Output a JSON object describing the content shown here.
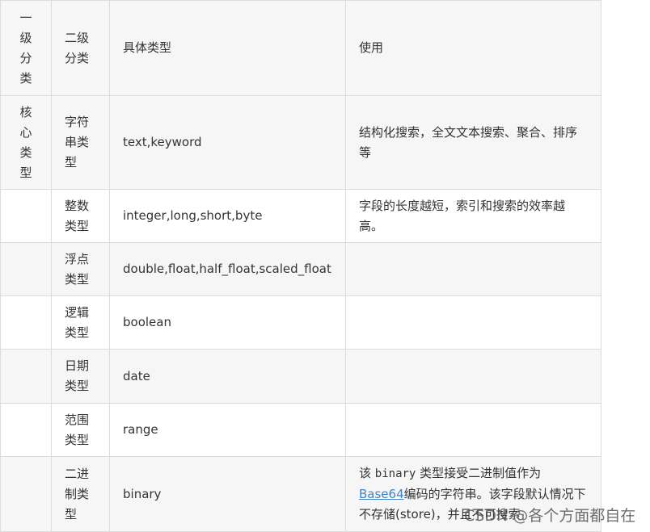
{
  "header": {
    "col1": "一级分类",
    "col2": "二级分类",
    "col3": "具体类型",
    "col4": "使用"
  },
  "rows": [
    {
      "col1": "核心类型",
      "col2": "字符串类型",
      "col3": "text,keyword",
      "col4": "结构化搜索，全文文本搜索、聚合、排序等"
    },
    {
      "col1": "",
      "col2": "整数类型",
      "col3": "integer,long,short,byte",
      "col4": "字段的长度越短，索引和搜索的效率越高。"
    },
    {
      "col1": "",
      "col2": "浮点类型",
      "col3": "double,float,half_float,scaled_float",
      "col4": ""
    },
    {
      "col1": "",
      "col2": "逻辑类型",
      "col3": "boolean",
      "col4": ""
    },
    {
      "col1": "",
      "col2": "日期类型",
      "col3": "date",
      "col4": ""
    },
    {
      "col1": "",
      "col2": "范围类型",
      "col3": "range",
      "col4": ""
    },
    {
      "col1": "",
      "col2": "二进制类型",
      "col3": "binary",
      "col4_parts": {
        "prefix": "该 ",
        "code": "binary",
        "mid": " 类型接受二进制值作为 ",
        "link": "Base64",
        "suffix": "编码的字符串。该字段默认情况下不存储(store)，并且不可搜索"
      }
    }
  ],
  "watermark": "CSDN @各个方面都自在"
}
